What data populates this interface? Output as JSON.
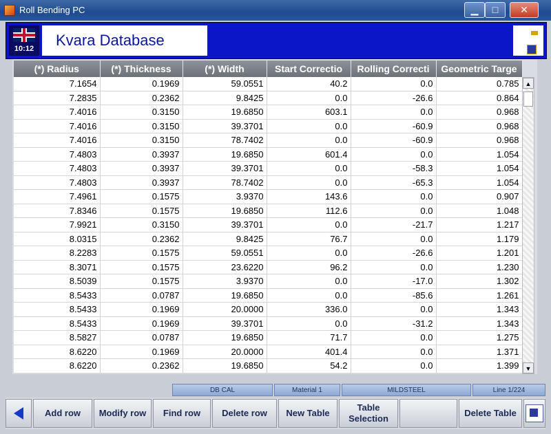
{
  "window": {
    "title": "Roll Bending PC",
    "minimize": "▁",
    "maximize": "□",
    "close": "✕"
  },
  "header": {
    "time": "10:12",
    "title": "Kvara Database"
  },
  "table": {
    "columns": [
      "(*) Radius",
      "(*) Thickness",
      "(*) Width",
      "Start Correctio",
      "Rolling Correcti",
      "Geometric Targe"
    ],
    "rows": [
      [
        "7.1654",
        "0.1969",
        "59.0551",
        "40.2",
        "0.0",
        "0.785"
      ],
      [
        "7.2835",
        "0.2362",
        "9.8425",
        "0.0",
        "-26.6",
        "0.864"
      ],
      [
        "7.4016",
        "0.3150",
        "19.6850",
        "603.1",
        "0.0",
        "0.968"
      ],
      [
        "7.4016",
        "0.3150",
        "39.3701",
        "0.0",
        "-60.9",
        "0.968"
      ],
      [
        "7.4016",
        "0.3150",
        "78.7402",
        "0.0",
        "-60.9",
        "0.968"
      ],
      [
        "7.4803",
        "0.3937",
        "19.6850",
        "601.4",
        "0.0",
        "1.054"
      ],
      [
        "7.4803",
        "0.3937",
        "39.3701",
        "0.0",
        "-58.3",
        "1.054"
      ],
      [
        "7.4803",
        "0.3937",
        "78.7402",
        "0.0",
        "-65.3",
        "1.054"
      ],
      [
        "7.4961",
        "0.1575",
        "3.9370",
        "143.6",
        "0.0",
        "0.907"
      ],
      [
        "7.8346",
        "0.1575",
        "19.6850",
        "112.6",
        "0.0",
        "1.048"
      ],
      [
        "7.9921",
        "0.3150",
        "39.3701",
        "0.0",
        "-21.7",
        "1.217"
      ],
      [
        "8.0315",
        "0.2362",
        "9.8425",
        "76.7",
        "0.0",
        "1.179"
      ],
      [
        "8.2283",
        "0.1575",
        "59.0551",
        "0.0",
        "-26.6",
        "1.201"
      ],
      [
        "8.3071",
        "0.1575",
        "23.6220",
        "96.2",
        "0.0",
        "1.230"
      ],
      [
        "8.5039",
        "0.1575",
        "3.9370",
        "0.0",
        "-17.0",
        "1.302"
      ],
      [
        "8.5433",
        "0.0787",
        "19.6850",
        "0.0",
        "-85.6",
        "1.261"
      ],
      [
        "8.5433",
        "0.1969",
        "20.0000",
        "336.0",
        "0.0",
        "1.343"
      ],
      [
        "8.5433",
        "0.1969",
        "39.3701",
        "0.0",
        "-31.2",
        "1.343"
      ],
      [
        "8.5827",
        "0.0787",
        "19.6850",
        "71.7",
        "0.0",
        "1.275"
      ],
      [
        "8.6220",
        "0.1969",
        "20.0000",
        "401.4",
        "0.0",
        "1.371"
      ],
      [
        "8.6220",
        "0.2362",
        "19.6850",
        "54.2",
        "0.0",
        "1.399"
      ]
    ]
  },
  "status": {
    "db": "DB CAL",
    "material": "Material 1",
    "steel": "MILDSTEEL",
    "line": "Line 1/224"
  },
  "toolbar": {
    "add_row": "Add row",
    "modify_row": "Modify row",
    "find_row": "Find row",
    "delete_row": "Delete row",
    "new_table": "New Table",
    "table_selection": "Table Selection",
    "delete_table": "Delete Table"
  },
  "colors": {
    "header_blue": "#0a16c8",
    "title_text": "#0a16a0",
    "toolbar_text": "#1a2a55"
  }
}
